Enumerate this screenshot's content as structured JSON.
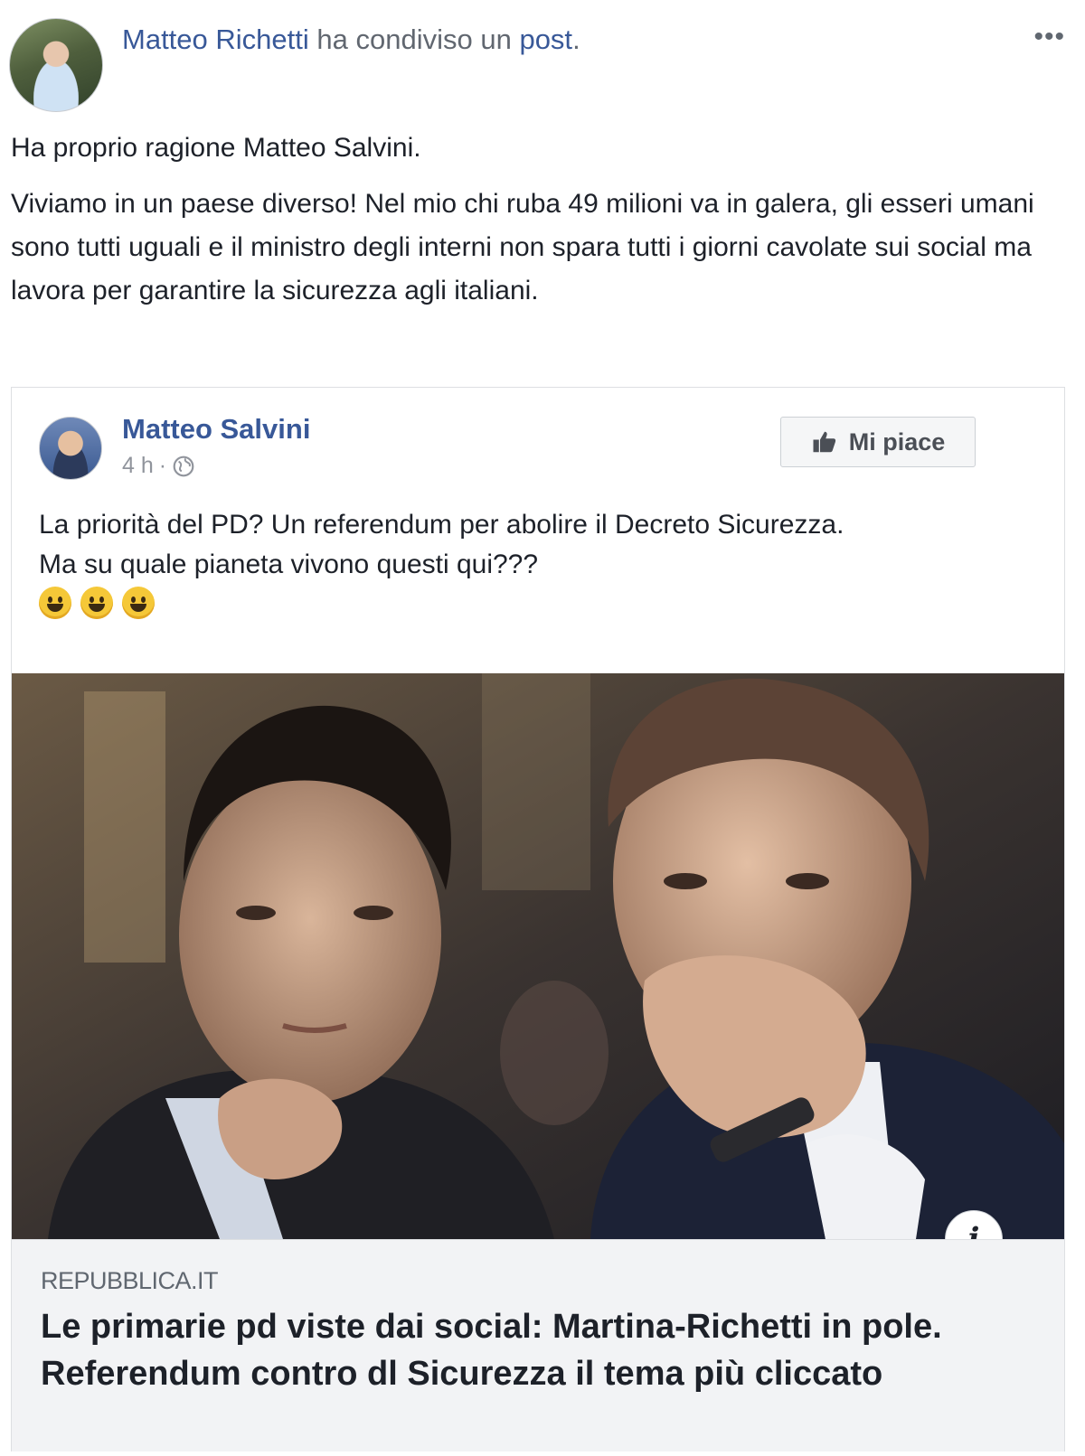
{
  "post": {
    "author": "Matteo Richetti",
    "action_text": "ha condiviso un",
    "shared_link_word": "post",
    "period": ".",
    "more_icon": "more-icon",
    "paragraph_1": "Ha proprio ragione Matteo Salvini.",
    "paragraph_2": "Viviamo in un paese diverso! Nel mio chi ruba 49 milioni va in galera, gli esseri umani sono tutti uguali e il ministro degli interni non spara tutti i giorni cavolate sui social ma lavora per garantire la sicurezza agli italiani."
  },
  "shared_post": {
    "author": "Matteo Salvini",
    "time": "4 h",
    "separator": "·",
    "privacy_icon": "globe-icon",
    "like_button_label": "Mi piace",
    "text_line_1": "La priorità del PD? Un referendum per abolire il Decreto Sicurezza.",
    "text_line_2": "Ma su quale pianeta vivono questi qui???",
    "emojis": [
      "grinning-face",
      "grinning-face",
      "grinning-face"
    ]
  },
  "link_preview": {
    "domain": "REPUBBLICA.IT",
    "title": "Le primarie pd viste dai social: Martina-Richetti in pole. Referendum contro dl Sicurezza il tema più cliccato",
    "info_label": "i"
  },
  "colors": {
    "link_blue": "#385898",
    "text": "#1d2129",
    "meta_gray": "#90949c",
    "footer_bg": "#f2f3f5"
  }
}
